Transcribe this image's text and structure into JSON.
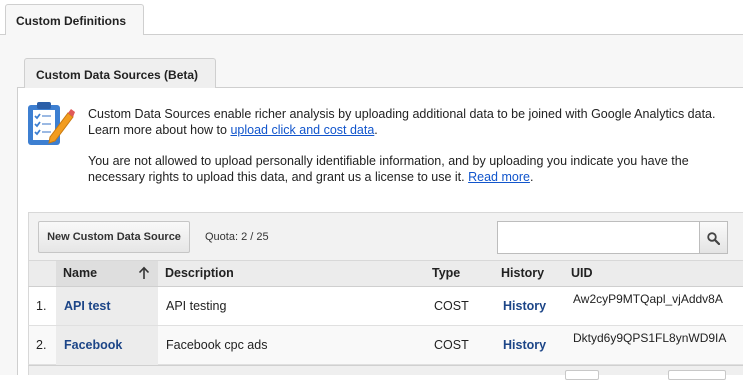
{
  "tabs": {
    "outer": "Custom Definitions",
    "inner": "Custom Data Sources (Beta)"
  },
  "info": {
    "paragraph1_text": "Custom Data Sources enable richer analysis by uploading additional data to be joined with Google Analytics data. Learn more about how to ",
    "paragraph1_link": "upload click and cost data",
    "paragraph1_end": ".",
    "paragraph2_text": "You are not allowed to upload personally identifiable information, and by uploading you indicate you have the necessary rights to upload this data, and grant us a license to use it. ",
    "paragraph2_link": "Read more",
    "paragraph2_end": "."
  },
  "toolbar": {
    "new_button_label": "New Custom Data Source",
    "quota": "Quota: 2 / 25",
    "search_placeholder": ""
  },
  "table": {
    "headers": {
      "name": "Name",
      "description": "Description",
      "type": "Type",
      "history": "History",
      "uid": "UID"
    },
    "rows": [
      {
        "index": "1.",
        "name": "API test",
        "description": "API testing",
        "type": "COST",
        "history": "History",
        "uid": "Aw2cyP9MTQapl_vjAddv8A"
      },
      {
        "index": "2.",
        "name": "Facebook",
        "description": "Facebook cpc ads",
        "type": "COST",
        "history": "History",
        "uid": "Dktyd6y9QPS1FL8ynWD9IA"
      }
    ]
  },
  "icons": {
    "info": "clipboard-checklist-icon",
    "search": "search-icon",
    "sort": "sort-ascending-icon"
  },
  "colors": {
    "link": "#1155cc",
    "name_link": "#1c4587",
    "icon_blue": "#3d7fd1",
    "icon_orange": "#f29c1f"
  }
}
